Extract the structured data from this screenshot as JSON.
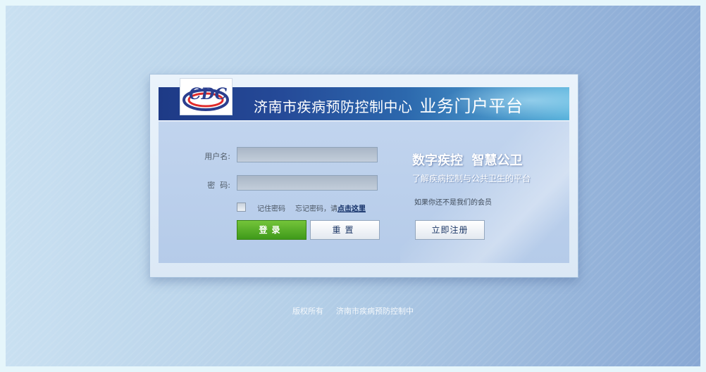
{
  "header": {
    "title": "济南市疾病预防控制中心",
    "subtitle": "业务门户平台",
    "logo_text": "CDC"
  },
  "login": {
    "username_label": "用户名:",
    "password_label": "密  码:",
    "username_value": "",
    "password_value": "",
    "remember_label": "记住密码",
    "forgot_prefix": "忘记密码，请",
    "forgot_link": "点击这里",
    "login_button": "登录",
    "reset_button": "重置"
  },
  "promo": {
    "slogan": "数字疾控  智慧公卫",
    "tagline": "了解疾病控制与公共卫生的平台",
    "member_note": "如果你还不是我们的会员",
    "register_button": "立即注册"
  },
  "footer": {
    "copyright": "版权所有",
    "org": "济南市疾病预防控制中"
  },
  "colors": {
    "banner": "#254a98",
    "login_button": "#4fa925",
    "link": "#0d2a63"
  }
}
